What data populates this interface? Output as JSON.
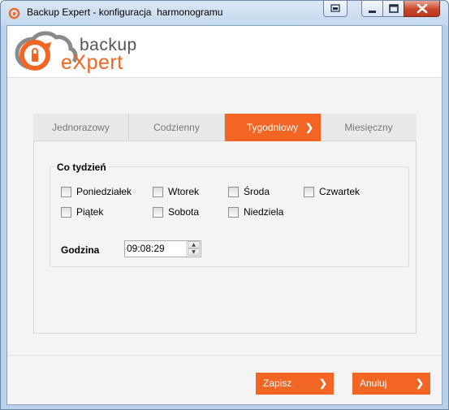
{
  "window": {
    "title": "Backup Expert - konfiguracja  harmonogramu"
  },
  "logo": {
    "line1": "backup",
    "line2": "eXpert"
  },
  "tabs": [
    {
      "label": "Jednorazowy",
      "active": false
    },
    {
      "label": "Codzienny",
      "active": false
    },
    {
      "label": "Tygodniowy",
      "active": true
    },
    {
      "label": "Miesięczny",
      "active": false
    }
  ],
  "weekly": {
    "group_title": "Co tydzień",
    "days": [
      {
        "label": "Poniedziałek",
        "checked": false
      },
      {
        "label": "Wtorek",
        "checked": false
      },
      {
        "label": "Środa",
        "checked": false
      },
      {
        "label": "Czwartek",
        "checked": false
      },
      {
        "label": "Piątek",
        "checked": false
      },
      {
        "label": "Sobota",
        "checked": false
      },
      {
        "label": "Niedziela",
        "checked": false
      }
    ],
    "hour_label": "Godzina",
    "hour_value": "09:08:29"
  },
  "footer": {
    "save_label": "Zapisz",
    "cancel_label": "Anuluj"
  },
  "colors": {
    "accent": "#f26522"
  },
  "icons": {
    "tab_arrow": "❯",
    "button_arrow": "❯"
  }
}
